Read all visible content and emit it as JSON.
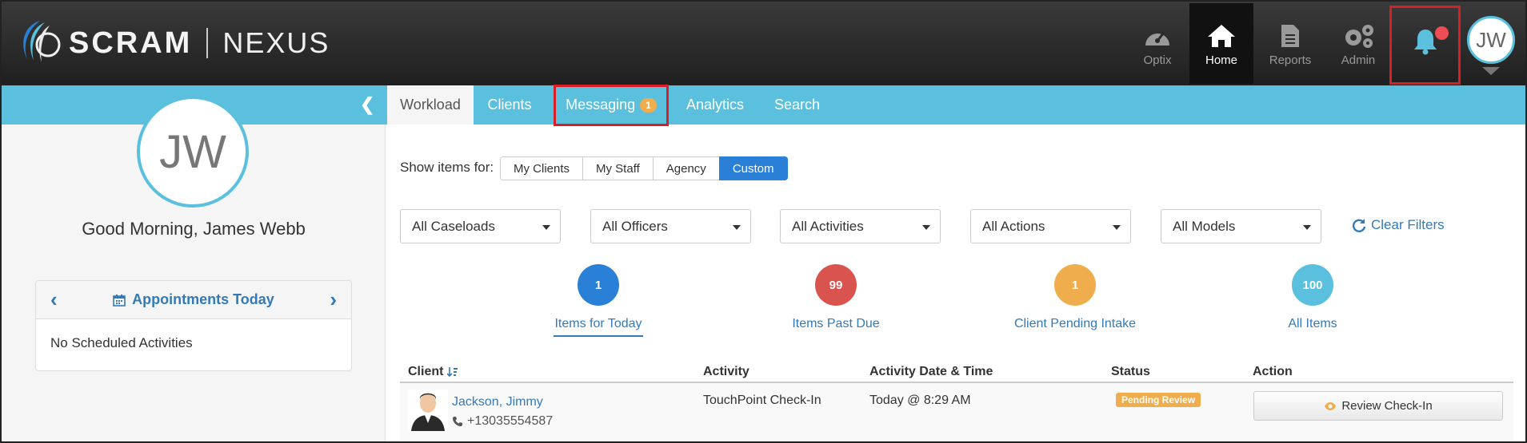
{
  "brand": {
    "name": "SCRAM",
    "product": "NEXUS"
  },
  "topnav": {
    "optix": "Optix",
    "home": "Home",
    "reports": "Reports",
    "admin": "Admin",
    "user_initials": "JW"
  },
  "tabs": {
    "workload": "Workload",
    "clients": "Clients",
    "messaging": "Messaging",
    "messaging_badge": "1",
    "analytics": "Analytics",
    "search": "Search"
  },
  "profile": {
    "initials": "JW",
    "greeting": "Good Morning, James Webb"
  },
  "appointments": {
    "title": "Appointments Today",
    "empty": "No Scheduled Activities"
  },
  "filters": {
    "show_label": "Show items for:",
    "scope": [
      "My Clients",
      "My Staff",
      "Agency",
      "Custom"
    ],
    "scope_selected": "Custom",
    "caseloads": "All Caseloads",
    "officers": "All Officers",
    "activities": "All Activities",
    "actions": "All Actions",
    "models": "All Models",
    "clear": "Clear Filters"
  },
  "stats": [
    {
      "value": "1",
      "label": "Items for Today",
      "color": "#2a7fd6"
    },
    {
      "value": "99",
      "label": "Items Past Due",
      "color": "#d9534f"
    },
    {
      "value": "1",
      "label": "Client Pending Intake",
      "color": "#f0ad4e"
    },
    {
      "value": "100",
      "label": "All Items",
      "color": "#5bc0de"
    }
  ],
  "table": {
    "headers": [
      "Client",
      "Activity",
      "Activity Date & Time",
      "Status",
      "Action"
    ],
    "rows": [
      {
        "client": "Jackson, Jimmy",
        "phone": "+13035554587",
        "activity": "TouchPoint Check-In",
        "datetime": "Today @ 8:29 AM",
        "status": "Pending Review",
        "action": "Review Check-In"
      }
    ]
  },
  "colors": {
    "accent": "#5bc0de",
    "primary": "#2a7fd6",
    "highlight": "#d81f26",
    "warning": "#f0ad4e",
    "danger": "#d9534f"
  }
}
